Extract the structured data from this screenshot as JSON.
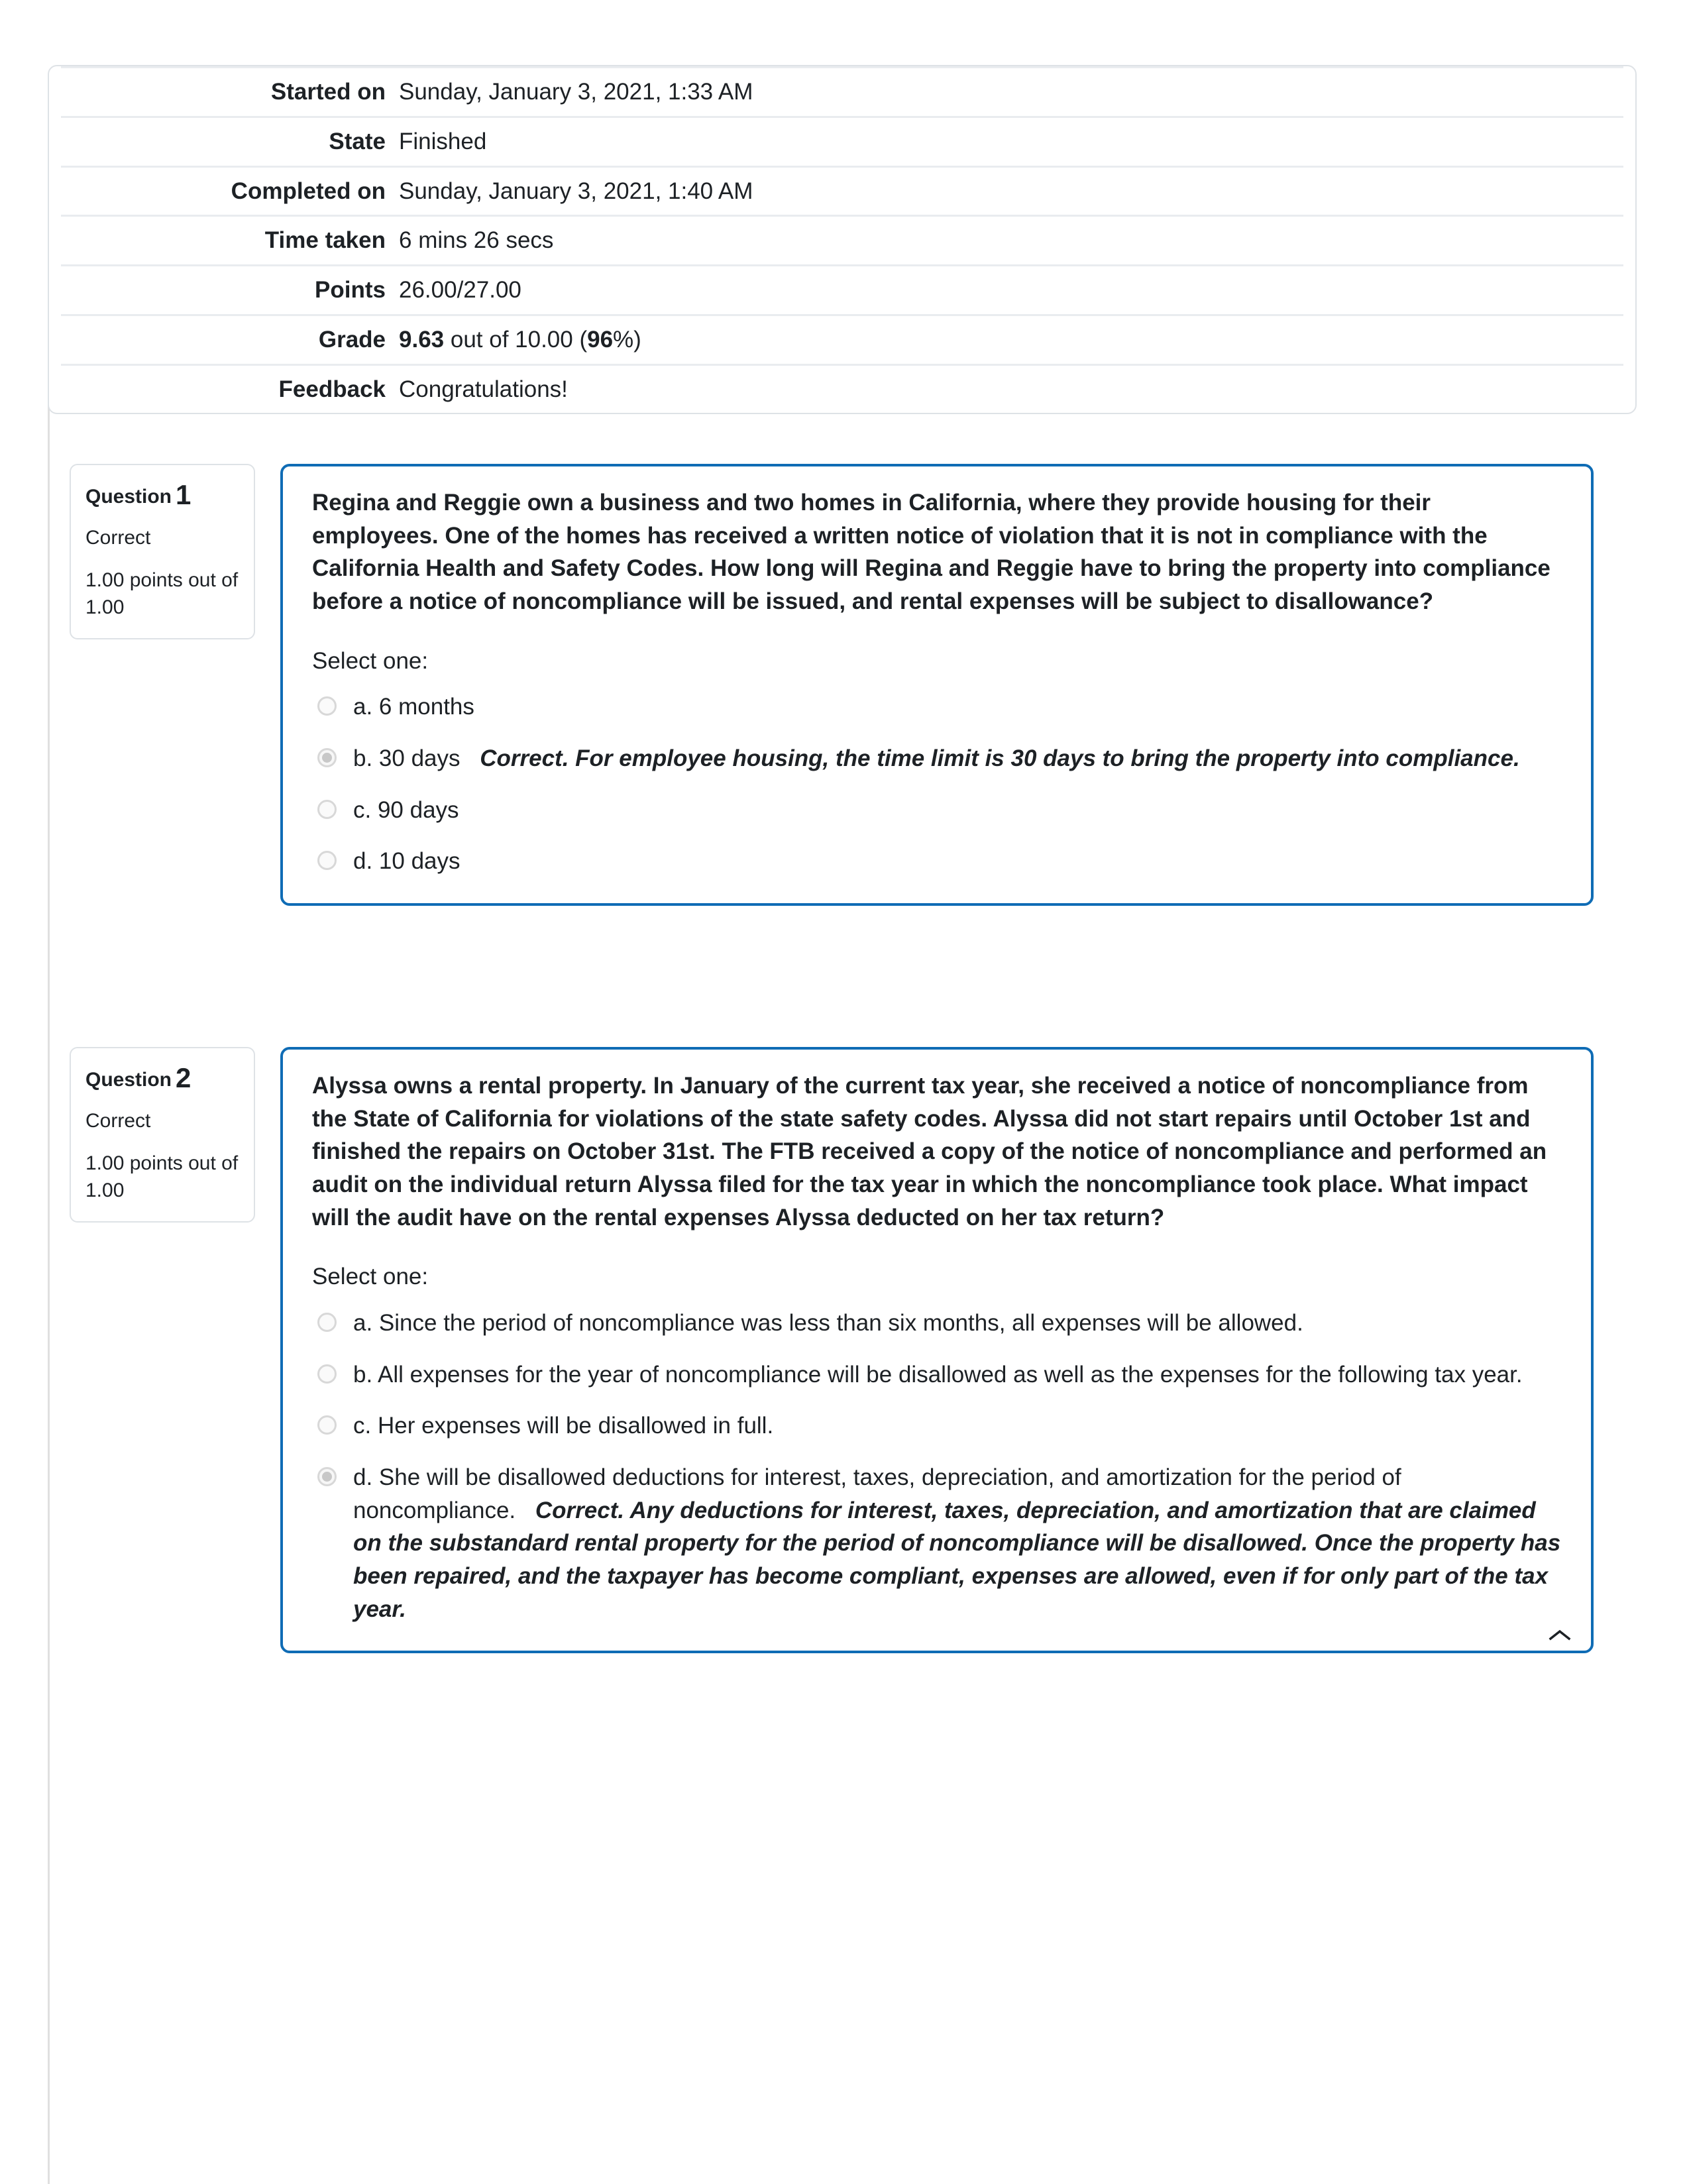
{
  "summary": {
    "rows": [
      {
        "label": "Started on",
        "value": "Sunday, January 3, 2021, 1:33 AM"
      },
      {
        "label": "State",
        "value": "Finished"
      },
      {
        "label": "Completed on",
        "value": "Sunday, January 3, 2021, 1:40 AM"
      },
      {
        "label": "Time taken",
        "value": "6 mins 26 secs"
      },
      {
        "label": "Points",
        "value": "26.00/27.00"
      },
      {
        "label": "Grade",
        "value": "9.63 out of 10.00 (96%)",
        "grade_value": "9.63",
        "grade_mid": " out of 10.00 (",
        "grade_pct": "96",
        "grade_end": "%)"
      },
      {
        "label": "Feedback",
        "value": "Congratulations!"
      }
    ]
  },
  "questions": [
    {
      "number_label": "Question",
      "number": "1",
      "state": "Correct",
      "marks": "1.00 points out of 1.00",
      "text": "Regina and Reggie own a business and two homes in California, where they provide housing for their employees.  One of the homes has received a written notice of violation that it is not in compliance with the California Health and Safety Codes.  How long will Regina and Reggie have to bring the property into compliance before a notice of noncompliance will be issued, and rental expenses will be subject to disallowance?",
      "select_label": "Select one:",
      "answers": [
        {
          "text": "a. 6 months",
          "selected": false,
          "feedback": ""
        },
        {
          "text": "b. 30 days",
          "selected": true,
          "feedback": "Correct.  For employee housing, the time limit is 30 days to bring the property into compliance."
        },
        {
          "text": "c. 90 days",
          "selected": false,
          "feedback": ""
        },
        {
          "text": "d. 10 days",
          "selected": false,
          "feedback": ""
        }
      ],
      "collapse_icon": "chevron-up-icon",
      "show_chevron": false
    },
    {
      "number_label": "Question",
      "number": "2",
      "state": "Correct",
      "marks": "1.00 points out of 1.00",
      "text": "Alyssa owns a rental property.  In January of the current tax year, she received a notice of noncompliance from the State of California for violations of the state safety codes.  Alyssa did not start repairs until October 1st and finished the repairs on October 31st.  The FTB received a copy of the notice of noncompliance and performed an audit on the individual return Alyssa filed for the tax year in which the noncompliance took place.  What impact will the audit have on the rental expenses Alyssa deducted on her tax return?",
      "select_label": "Select one:",
      "answers": [
        {
          "text": "a. Since the period of noncompliance was less than six months, all expenses will be allowed.",
          "selected": false,
          "feedback": ""
        },
        {
          "text": "b. All expenses for the year of noncompliance will be disallowed as well as the expenses for the following tax year.",
          "selected": false,
          "feedback": ""
        },
        {
          "text": "c. Her expenses will be disallowed in full.",
          "selected": false,
          "feedback": ""
        },
        {
          "text": "d. She will be disallowed deductions for interest, taxes, depreciation, and amortization for the period of noncompliance.",
          "selected": true,
          "feedback": "Correct.  Any deductions for interest, taxes, depreciation, and amortization that are claimed on the substandard rental property for the period of noncompliance will be disallowed.  Once the property has been repaired, and the taxpayer has become compliant, expenses are allowed, even if for only part of the tax year."
        }
      ],
      "collapse_icon": "chevron-up-icon",
      "show_chevron": true
    }
  ],
  "colors": {
    "question_border": "#0f6cb5",
    "card_border": "#dee2e6",
    "row_divider": "#e9ecef",
    "text": "#1d2125"
  }
}
